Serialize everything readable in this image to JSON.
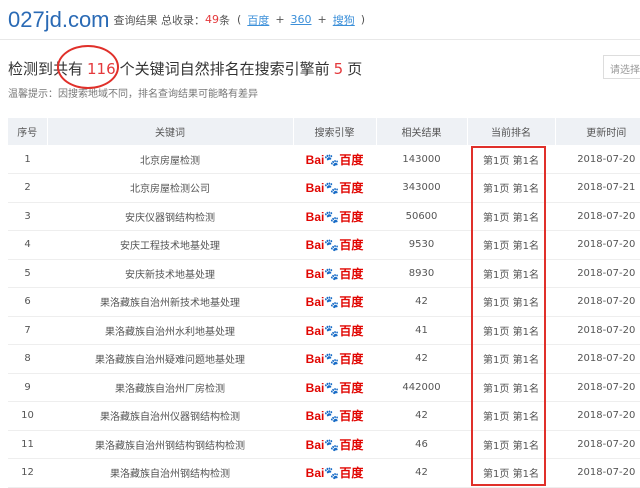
{
  "header": {
    "logo": "027jd.com",
    "query_label": "查询结果",
    "total_label": "总收录：",
    "total": "49",
    "unit": "条",
    "open": "(",
    "engines": [
      "百度",
      "360",
      "搜狗"
    ],
    "plus": "+",
    "close": ")"
  },
  "summary": {
    "prefix": "检测到共有",
    "count": "116",
    "middle": "个关键词自然排名在搜索引擎前",
    "pages": "5",
    "suffix": "页"
  },
  "tip": "温馨提示：因搜索地域不同，排名查询结果可能略有差异",
  "select": {
    "placeholder": "请选择"
  },
  "table": {
    "headers": [
      "序号",
      "关键词",
      "搜索引擎",
      "相关结果",
      "当前排名",
      "更新时间"
    ],
    "engine_logo": {
      "text1": "Bai",
      "text2": "百度",
      "icon": "baidu-paw-icon"
    },
    "rows": [
      [
        "1",
        "北京房屋检测",
        "143000",
        "第1页 第1名",
        "2018-07-20"
      ],
      [
        "2",
        "北京房屋检测公司",
        "343000",
        "第1页 第1名",
        "2018-07-21"
      ],
      [
        "3",
        "安庆仪器钢结构检测",
        "50600",
        "第1页 第1名",
        "2018-07-20"
      ],
      [
        "4",
        "安庆工程技术地基处理",
        "9530",
        "第1页 第1名",
        "2018-07-20"
      ],
      [
        "5",
        "安庆新技术地基处理",
        "8930",
        "第1页 第1名",
        "2018-07-20"
      ],
      [
        "6",
        "果洛藏族自治州新技术地基处理",
        "42",
        "第1页 第1名",
        "2018-07-20"
      ],
      [
        "7",
        "果洛藏族自治州水利地基处理",
        "41",
        "第1页 第1名",
        "2018-07-20"
      ],
      [
        "8",
        "果洛藏族自治州疑难问题地基处理",
        "42",
        "第1页 第1名",
        "2018-07-20"
      ],
      [
        "9",
        "果洛藏族自治州厂房检测",
        "442000",
        "第1页 第1名",
        "2018-07-20"
      ],
      [
        "10",
        "果洛藏族自治州仪器钢结构检测",
        "42",
        "第1页 第1名",
        "2018-07-20"
      ],
      [
        "11",
        "果洛藏族自治州钢结构钢结构检测",
        "46",
        "第1页 第1名",
        "2018-07-20"
      ],
      [
        "12",
        "果洛藏族自治州钢结构检测",
        "42",
        "第1页 第1名",
        "2018-07-20"
      ]
    ]
  },
  "colors": {
    "accent": "#e4393c",
    "link": "#3b8fd9",
    "logo": "#2a6ab5",
    "annotation": "#e0302a"
  }
}
